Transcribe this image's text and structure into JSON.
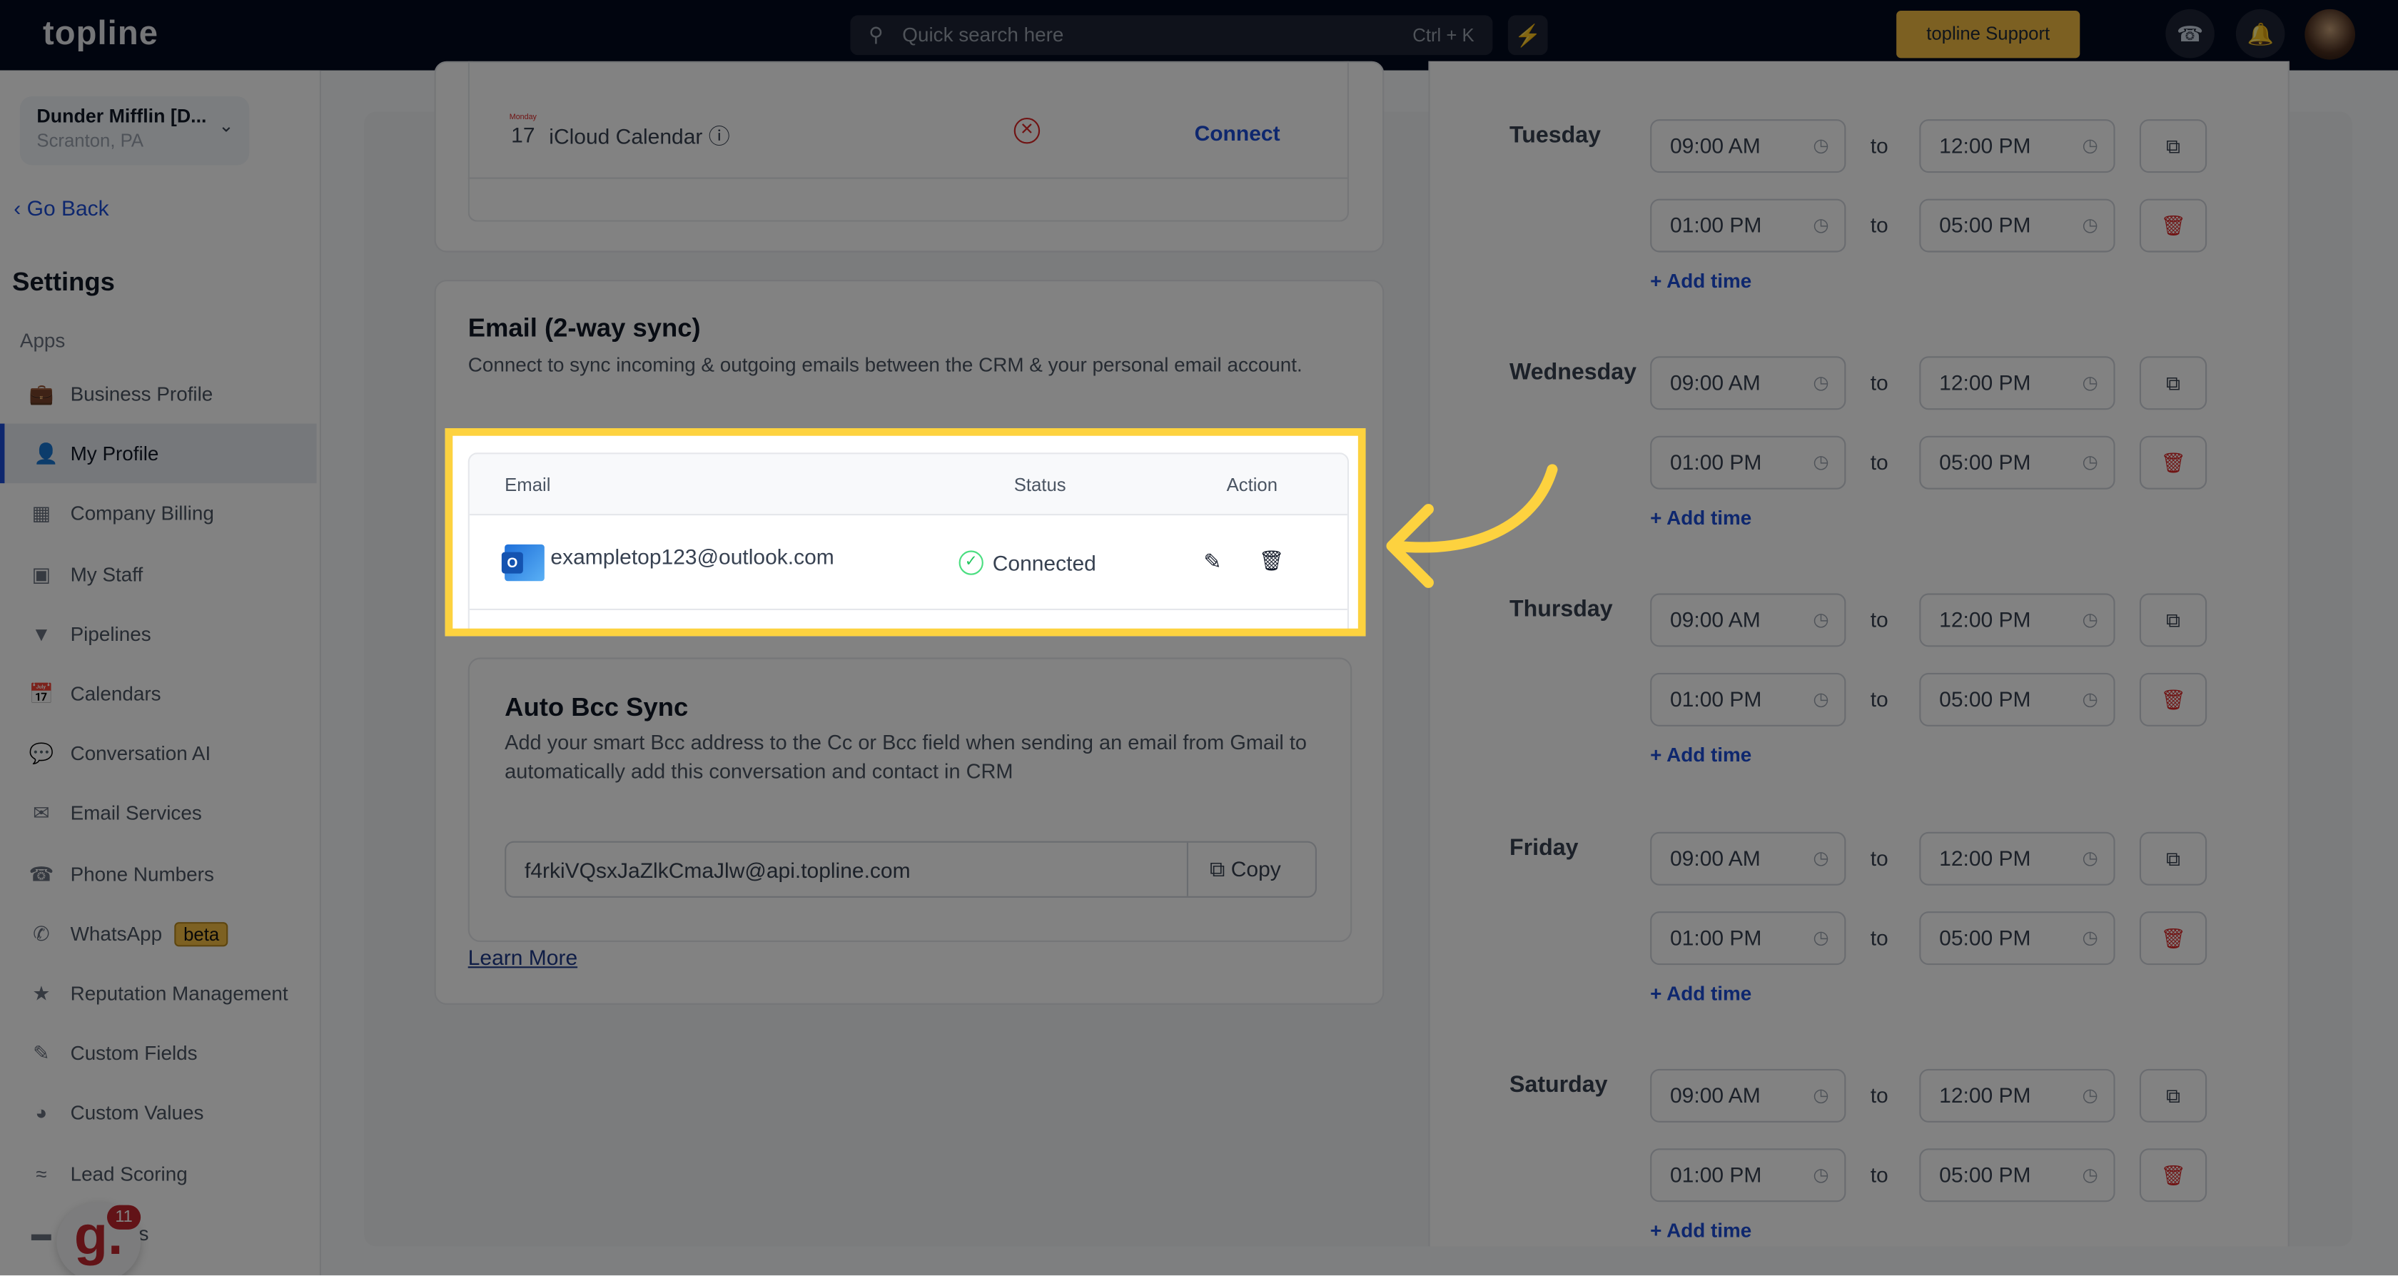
{
  "topnav": {
    "logo": "topline",
    "search_placeholder": "Quick search here",
    "search_shortcut": "Ctrl + K",
    "support_label": "topline Support",
    "colors": {
      "nav_bg": "#030a1f",
      "support": "#f4bd44",
      "bolt": "#f5be44"
    }
  },
  "sidebar": {
    "account_name": "Dunder Mifflin [D...",
    "account_location": "Scranton, PA",
    "go_back": "Go Back",
    "title": "Settings",
    "section": "Apps",
    "items": [
      {
        "label": "Business Profile",
        "icon": "briefcase-icon"
      },
      {
        "label": "My Profile",
        "icon": "user-icon",
        "active": true
      },
      {
        "label": "Company Billing",
        "icon": "calculator-icon"
      },
      {
        "label": "My Staff",
        "icon": "inbox-icon"
      },
      {
        "label": "Pipelines",
        "icon": "filter-icon"
      },
      {
        "label": "Calendars",
        "icon": "calendar-icon"
      },
      {
        "label": "Conversation AI",
        "icon": "chat-icon"
      },
      {
        "label": "Email Services",
        "icon": "mail-icon"
      },
      {
        "label": "Phone Numbers",
        "icon": "phone-icon"
      },
      {
        "label": "WhatsApp",
        "icon": "whatsapp-icon",
        "badge": "beta"
      },
      {
        "label": "Reputation Management",
        "icon": "star-icon"
      },
      {
        "label": "Custom Fields",
        "icon": "edit-field-icon"
      },
      {
        "label": "Custom Values",
        "icon": "pie-icon"
      },
      {
        "label": "Lead Scoring",
        "icon": "chart-icon"
      },
      {
        "label": "Domains",
        "icon": "domain-icon"
      }
    ],
    "widget_count": "11"
  },
  "calendar_card": {
    "name": "iCloud Calendar",
    "icon_month": "Monday",
    "icon_day": "17",
    "connect": "Connect"
  },
  "email_sync": {
    "title": "Email (2-way sync)",
    "description": "Connect to sync incoming & outgoing emails between the CRM & your personal email account.",
    "columns": [
      "Email",
      "Status",
      "Action"
    ],
    "rows": [
      {
        "email": "exampletop123@outlook.com",
        "status": "Connected"
      }
    ]
  },
  "auto_bcc": {
    "title": "Auto Bcc Sync",
    "description": "Add your smart Bcc address to the Cc or Bcc field when sending an email from Gmail to automatically add this conversation and contact in CRM",
    "address": "f4rkiVQsxJaZlkCmaJlw@api.topline.com",
    "copy": "Copy",
    "learn_more": "Learn More"
  },
  "schedule": {
    "to": "to",
    "add_time": "+ Add time",
    "days": [
      {
        "day": "Tuesday",
        "slots": [
          [
            "09:00 AM",
            "12:00 PM"
          ],
          [
            "01:00 PM",
            "05:00 PM"
          ]
        ]
      },
      {
        "day": "Wednesday",
        "slots": [
          [
            "09:00 AM",
            "12:00 PM"
          ],
          [
            "01:00 PM",
            "05:00 PM"
          ]
        ]
      },
      {
        "day": "Thursday",
        "slots": [
          [
            "09:00 AM",
            "12:00 PM"
          ],
          [
            "01:00 PM",
            "05:00 PM"
          ]
        ]
      },
      {
        "day": "Friday",
        "slots": [
          [
            "09:00 AM",
            "12:00 PM"
          ],
          [
            "01:00 PM",
            "05:00 PM"
          ]
        ]
      },
      {
        "day": "Saturday",
        "slots": [
          [
            "09:00 AM",
            "12:00 PM"
          ],
          [
            "01:00 PM",
            "05:00 PM"
          ]
        ]
      }
    ]
  },
  "highlight_color": "#fdd23f"
}
